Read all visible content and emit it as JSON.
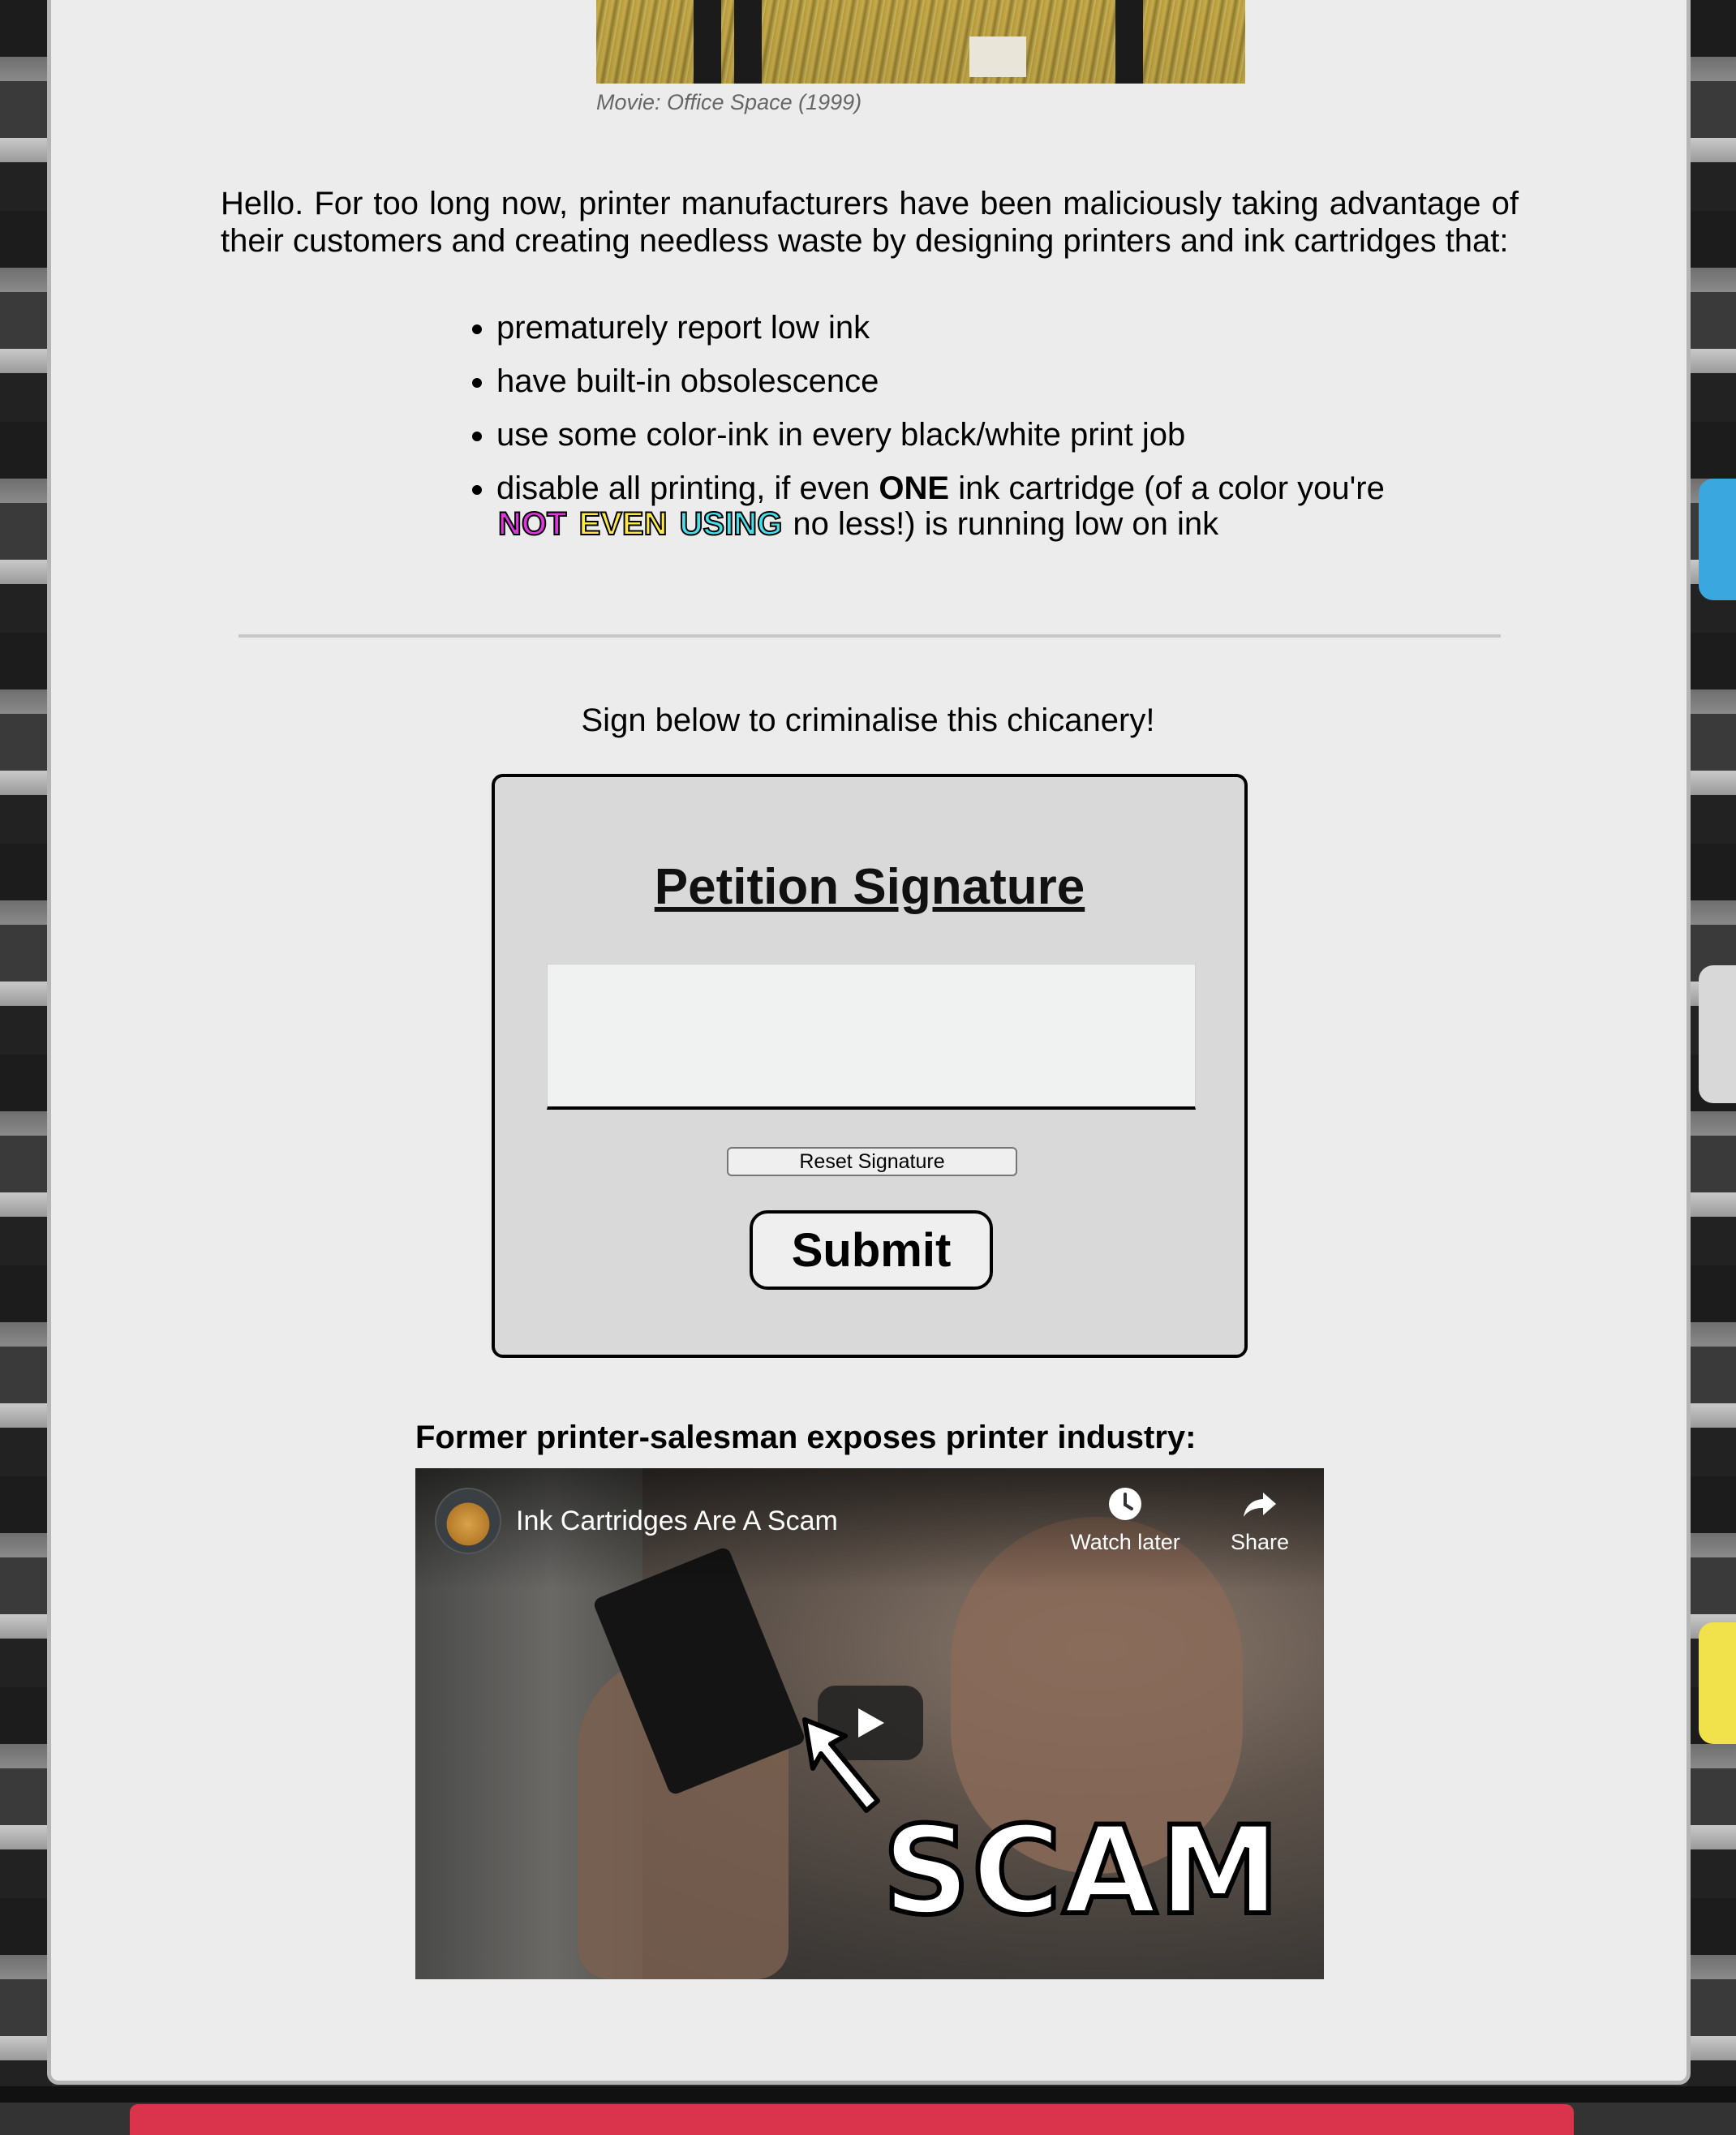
{
  "hero": {
    "caption": "Movie: Office Space (1999)"
  },
  "intro": {
    "text": "Hello. For too long now, printer manufacturers have been maliciously taking advantage of their customers and creating needless waste by designing printers and ink cartridges that:"
  },
  "bullets": {
    "item1": "prematurely report low ink",
    "item2": "have built-in obsolescence",
    "item3": "use some color-ink in every black/white print job",
    "item4_part1": "disable all printing, if even ",
    "item4_one": "ONE",
    "item4_part2": " ink cartridge (of a color you're ",
    "item4_not": "NOT",
    "item4_even": "EVEN",
    "item4_using": "USING",
    "item4_part3": " no less!) is running low on ink"
  },
  "petition": {
    "prompt": "Sign below to criminalise this chicanery!",
    "title": "Petition Signature",
    "reset_label": "Reset Signature",
    "submit_label": "Submit"
  },
  "video_section": {
    "heading": "Former printer-salesman exposes printer industry:",
    "title": "Ink Cartridges Are A Scam",
    "watch_later_label": "Watch later",
    "share_label": "Share",
    "thumbnail_text": "SCAM"
  },
  "colors": {
    "page_background": "#ececec",
    "petition_background": "#dad9d9",
    "highlight_magenta": "#e036e0",
    "highlight_yellow": "#ffe94a",
    "highlight_cyan": "#46e0ea"
  },
  "icons": {
    "watch_later": "clock-icon",
    "share": "share-arrow-icon",
    "play": "play-icon"
  }
}
